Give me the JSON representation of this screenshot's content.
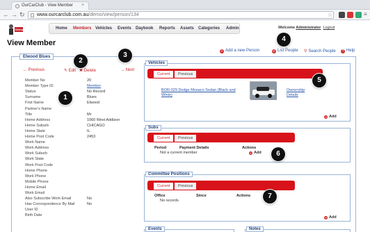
{
  "browser": {
    "tab_title": "OurCarClub - View Member",
    "tab_close": "×",
    "back": "←",
    "forward": "→",
    "reload": "↻",
    "url_domain": "www.ourcarclub.com.au",
    "url_path": "/demo/view/person/134",
    "star": "☆"
  },
  "logo": {
    "text": "Demo"
  },
  "menu": {
    "items": [
      "Home",
      "Members",
      "Vehicles",
      "Events",
      "Daybook",
      "Reports",
      "Assets",
      "Categories",
      "Admin"
    ],
    "active": "Members"
  },
  "welcome": {
    "prefix": "Welcome ",
    "user": "Administrator",
    "logout": "Logout"
  },
  "page_title": "View Member",
  "actions": {
    "add_person": "Add a new Person",
    "list_people": "List People",
    "search_people": "Search People",
    "help": "Help"
  },
  "record": {
    "legend": "Elwood Blues",
    "previous": "← Previous",
    "edit": "✎ Edit",
    "delete": "✖ Delete",
    "next": "→ Next"
  },
  "fields": [
    {
      "label": "Member No",
      "value": "20"
    },
    {
      "label": "Member Type ID",
      "value": "Member",
      "link": true
    },
    {
      "label": "Status",
      "value": "No Record"
    },
    {
      "label": "Surname",
      "value": "Blues"
    },
    {
      "label": "First Name",
      "value": "Elwood"
    },
    {
      "label": "Partner's Name",
      "value": ""
    },
    {
      "label": "Title",
      "value": "Mr"
    },
    {
      "label": "Home Address",
      "value": "1060 West Addison"
    },
    {
      "label": "Home Suburb",
      "value": "CHICAGO"
    },
    {
      "label": "Home State",
      "value": "IL"
    },
    {
      "label": "Home Post Code",
      "value": "2453"
    },
    {
      "label": "Work Name",
      "value": ""
    },
    {
      "label": "Work Address",
      "value": ""
    },
    {
      "label": "Work Suburb",
      "value": ""
    },
    {
      "label": "Work State",
      "value": ""
    },
    {
      "label": "Work Post Code",
      "value": ""
    },
    {
      "label": "Home Phone",
      "value": ""
    },
    {
      "label": "Work Phone",
      "value": ""
    },
    {
      "label": "Mobile Phone",
      "value": ""
    },
    {
      "label": "Home Email",
      "value": ""
    },
    {
      "label": "Work Email",
      "value": ""
    },
    {
      "label": "Also Subscribe Work Email",
      "value": "No"
    },
    {
      "label": "Has Correspondence By Mail",
      "value": "No"
    },
    {
      "label": "User ID",
      "value": ""
    },
    {
      "label": "Birth Date",
      "value": ""
    }
  ],
  "tabs": {
    "current": "Current",
    "previous": "Previous"
  },
  "vehicles": {
    "title": "Vehicles",
    "vehicle_name": "BOR-029 Dodge Monaco Sedan (Black and White)",
    "ownership": "Ownership Details",
    "add": "Add"
  },
  "subs": {
    "title": "Subs",
    "col_period": "Period",
    "col_payment": "Payment Details",
    "col_actions": "Actions",
    "empty": "Not a current member",
    "add": "Add"
  },
  "committee": {
    "title": "Committee Positions",
    "col_office": "Office",
    "col_since": "Since",
    "col_actions": "Actions",
    "empty": "No records",
    "add": "Add"
  },
  "events": {
    "title": "Events"
  },
  "notes": {
    "title": "Notes"
  },
  "callouts": [
    "1",
    "2",
    "3",
    "4",
    "5",
    "6",
    "7"
  ],
  "colors": {
    "accent_red": "#d8121b",
    "link_blue": "#2a57a8",
    "border_blue": "#9ab3d6"
  }
}
